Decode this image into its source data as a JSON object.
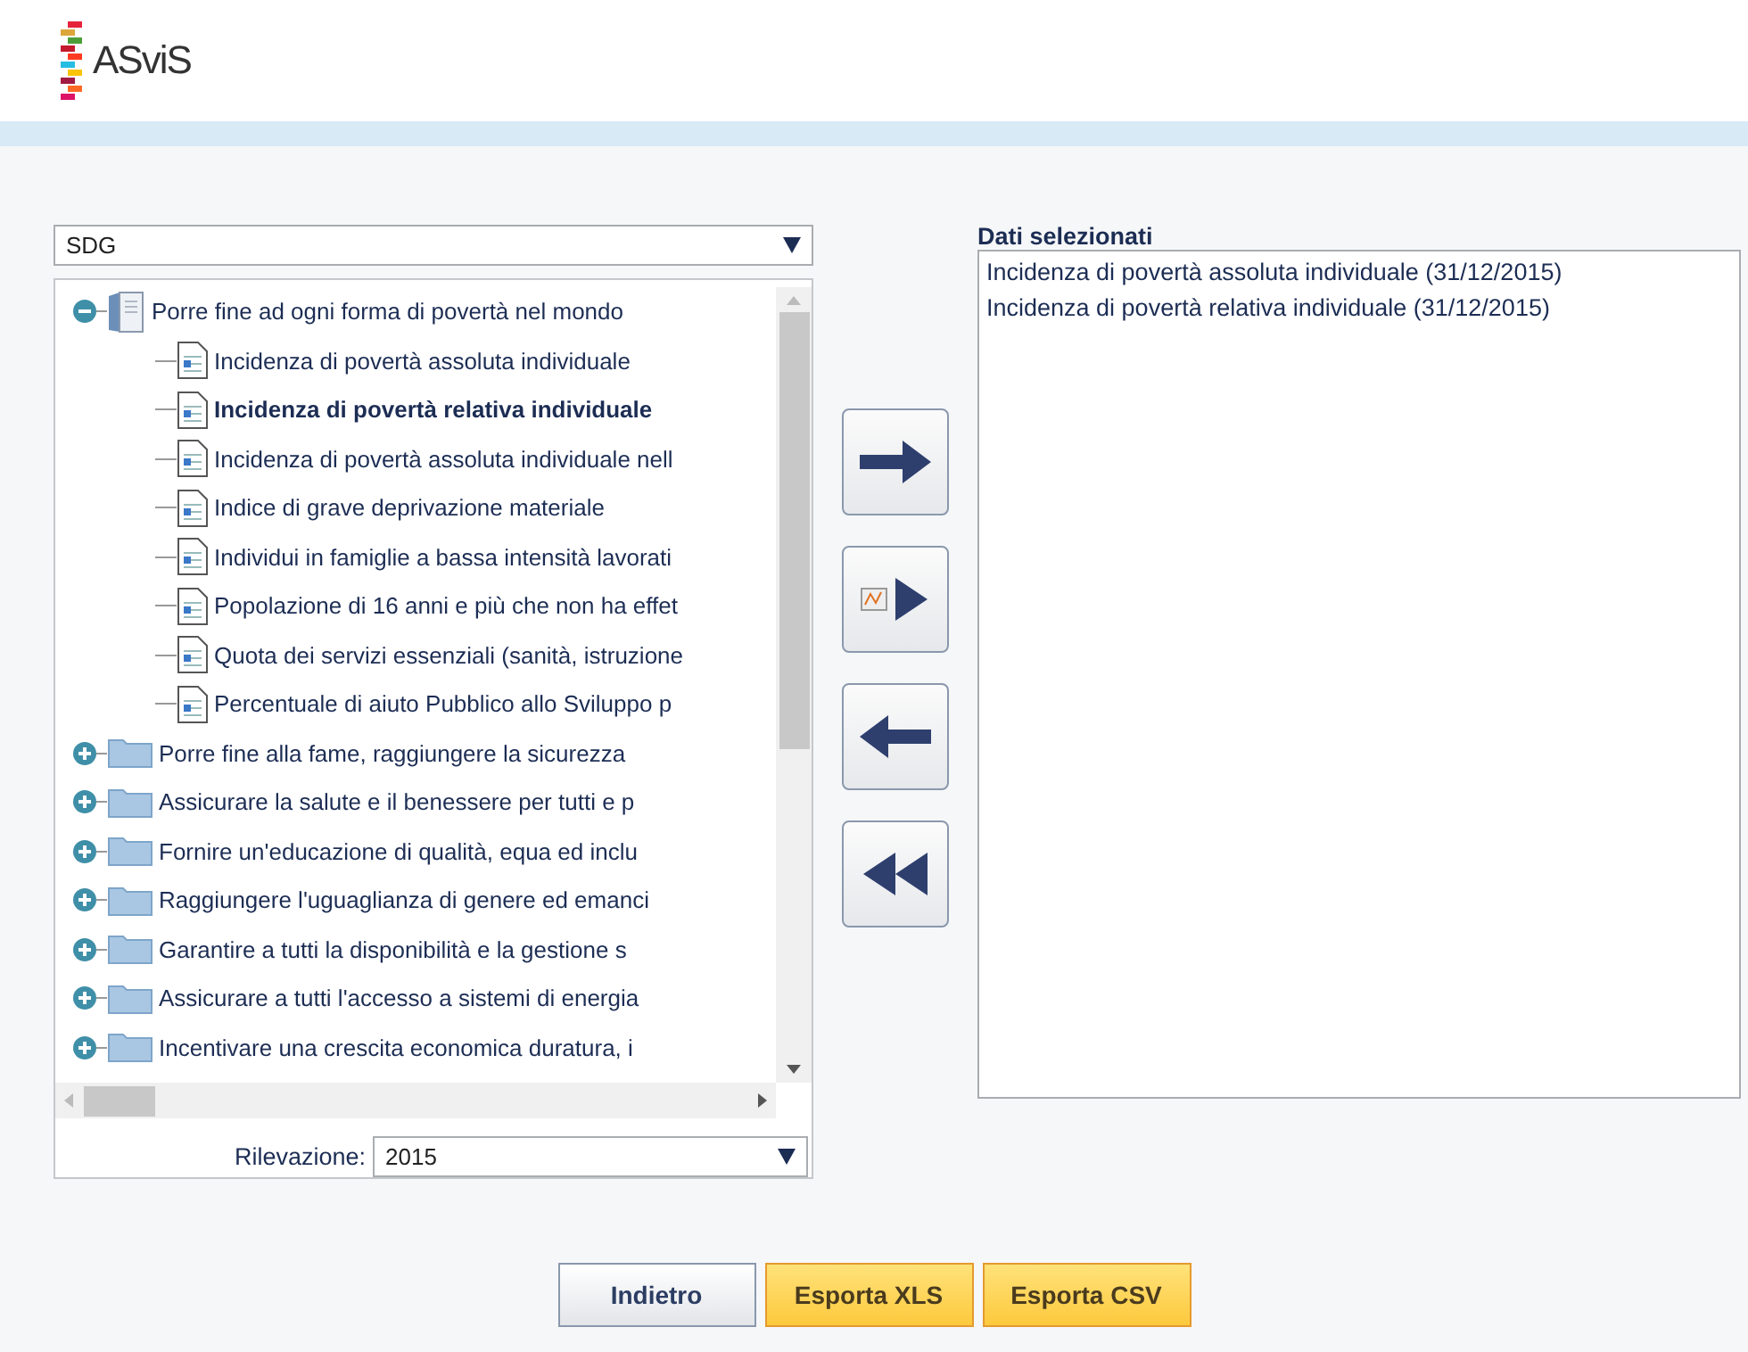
{
  "logo": {
    "text": "ASviS"
  },
  "category_select": {
    "value": "SDG"
  },
  "tree": [
    {
      "label": "Porre fine ad ogni forma di povertà nel mondo",
      "expanded": true,
      "selected": false,
      "children": [
        {
          "label": "Incidenza di povertà assoluta individuale",
          "selected": false
        },
        {
          "label": "Incidenza di povertà relativa individuale",
          "selected": true
        },
        {
          "label": "Incidenza di povertà assoluta individuale nell",
          "selected": false
        },
        {
          "label": "Indice di grave deprivazione materiale",
          "selected": false
        },
        {
          "label": "Individui in famiglie a bassa intensità lavorati",
          "selected": false
        },
        {
          "label": "Popolazione di 16 anni e più che non ha effet",
          "selected": false
        },
        {
          "label": "Quota dei servizi essenziali (sanità, istruzione",
          "selected": false
        },
        {
          "label": "Percentuale di aiuto Pubblico allo Sviluppo p",
          "selected": false
        }
      ]
    },
    {
      "label": "Porre fine alla fame, raggiungere la sicurezza",
      "expanded": false,
      "selected": false
    },
    {
      "label": "Assicurare la salute e il benessere per tutti e p",
      "expanded": false,
      "selected": false
    },
    {
      "label": "Fornire un'educazione di qualità, equa ed inclu",
      "expanded": false,
      "selected": false
    },
    {
      "label": "Raggiungere l'uguaglianza di genere ed emanci",
      "expanded": false,
      "selected": false
    },
    {
      "label": "Garantire a tutti la disponibilità e la gestione s",
      "expanded": false,
      "selected": false
    },
    {
      "label": "Assicurare a tutti l'accesso a sistemi di energia",
      "expanded": false,
      "selected": false
    },
    {
      "label": "Incentivare una crescita economica duratura, i",
      "expanded": false,
      "selected": false
    }
  ],
  "survey": {
    "label": "Rilevazione:",
    "value": "2015"
  },
  "selected_data": {
    "title": "Dati selezionati",
    "items": [
      {
        "label": "Incidenza di povertà assoluta individuale (31/12/2015)"
      },
      {
        "label": "Incidenza di povertà relativa individuale (31/12/2015)"
      }
    ]
  },
  "transfer_buttons": [
    {
      "kind": "add"
    },
    {
      "kind": "chart"
    },
    {
      "kind": "remove"
    },
    {
      "kind": "clear"
    }
  ],
  "buttons": [
    {
      "label": "Indietro",
      "kind": "secondary"
    },
    {
      "label": "Esporta XLS",
      "kind": "primary"
    },
    {
      "label": "Esporta CSV",
      "kind": "primary"
    }
  ]
}
